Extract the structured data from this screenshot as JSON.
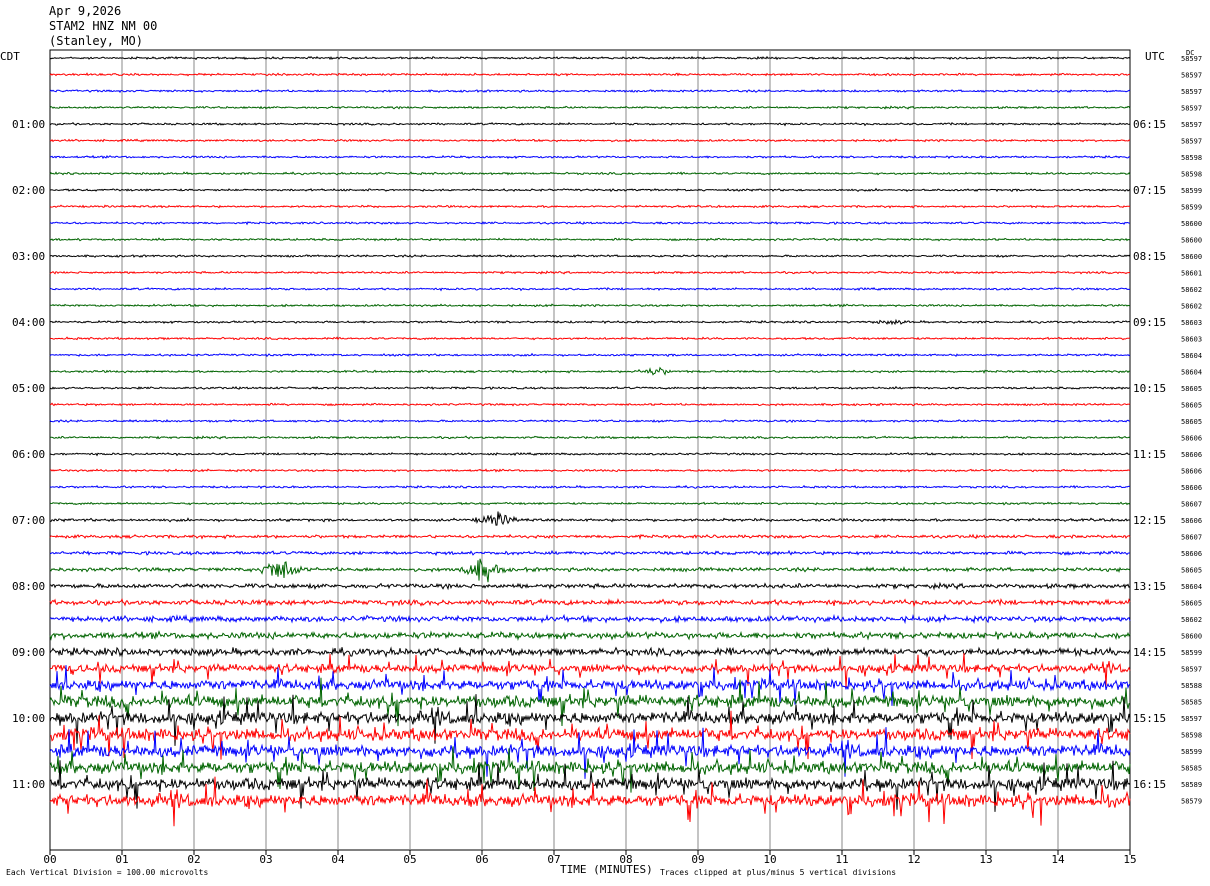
{
  "header": {
    "date": "Apr 9,2026",
    "station": "STAM2 HNZ NM 00",
    "location": "(Stanley, MO)"
  },
  "left_tz": "CDT",
  "right_tz": "UTC",
  "dc_label": "DC",
  "footer": {
    "scale_note": "Each Vertical Division = 100.00 microvolts",
    "time_axis_label": "TIME (MINUTES)",
    "clip_note": "Traces clipped at plus/minus 5 vertical divisions"
  },
  "chart_data": {
    "type": "line",
    "title": "STAM2 HNZ NM 00 helicorder",
    "line_minutes": 15,
    "x_ticks": [
      "00",
      "01",
      "02",
      "03",
      "04",
      "05",
      "06",
      "07",
      "08",
      "09",
      "10",
      "11",
      "12",
      "13",
      "14",
      "15"
    ],
    "trace_colors": [
      "#000000",
      "#ff0000",
      "#0000ff",
      "#006400"
    ],
    "left_labels": [
      {
        "line": 4,
        "text": "01:00"
      },
      {
        "line": 8,
        "text": "02:00"
      },
      {
        "line": 12,
        "text": "03:00"
      },
      {
        "line": 16,
        "text": "04:00"
      },
      {
        "line": 20,
        "text": "05:00"
      },
      {
        "line": 24,
        "text": "06:00"
      },
      {
        "line": 28,
        "text": "07:00"
      },
      {
        "line": 32,
        "text": "08:00"
      },
      {
        "line": 36,
        "text": "09:00"
      },
      {
        "line": 40,
        "text": "10:00"
      },
      {
        "line": 44,
        "text": "11:00"
      }
    ],
    "right_labels": [
      {
        "line": 4,
        "text": "06:15"
      },
      {
        "line": 8,
        "text": "07:15"
      },
      {
        "line": 12,
        "text": "08:15"
      },
      {
        "line": 16,
        "text": "09:15"
      },
      {
        "line": 20,
        "text": "10:15"
      },
      {
        "line": 24,
        "text": "11:15"
      },
      {
        "line": 28,
        "text": "12:15"
      },
      {
        "line": 32,
        "text": "13:15"
      },
      {
        "line": 36,
        "text": "14:15"
      },
      {
        "line": 40,
        "text": "15:15"
      },
      {
        "line": 44,
        "text": "16:15"
      }
    ],
    "dc_offsets": [
      "58597",
      "58597",
      "58597",
      "58597",
      "58597",
      "58597",
      "58598",
      "58598",
      "58599",
      "58599",
      "58600",
      "58600",
      "58600",
      "58601",
      "58602",
      "58602",
      "58603",
      "58603",
      "58604",
      "58604",
      "58605",
      "58605",
      "58605",
      "58606",
      "58606",
      "58606",
      "58606",
      "58607",
      "58606",
      "58607",
      "58606",
      "58605",
      "58604",
      "58605",
      "58602",
      "58600",
      "58599",
      "58597",
      "58588",
      "58585",
      "58597",
      "58598",
      "58599",
      "58585",
      "58589",
      "58579"
    ],
    "trace_activity": [
      1,
      1,
      1,
      1,
      1,
      1,
      1,
      1,
      1,
      1,
      1,
      1,
      1,
      1,
      1,
      1,
      1,
      1,
      1,
      1,
      1,
      1,
      1,
      1,
      1,
      1,
      1,
      1,
      1.3,
      1.5,
      1.6,
      1.8,
      2.2,
      2.5,
      2.8,
      3.2,
      3.6,
      4,
      5,
      6,
      6,
      6,
      6,
      6,
      6,
      6
    ],
    "events": [
      {
        "line": 16,
        "minute": 11.7,
        "amplitude": 2
      },
      {
        "line": 19,
        "minute": 8.4,
        "amplitude": 5
      },
      {
        "line": 28,
        "minute": 6.2,
        "amplitude": 9
      },
      {
        "line": 31,
        "minute": 3.2,
        "amplitude": 16
      },
      {
        "line": 31,
        "minute": 6.0,
        "amplitude": 16
      }
    ]
  }
}
